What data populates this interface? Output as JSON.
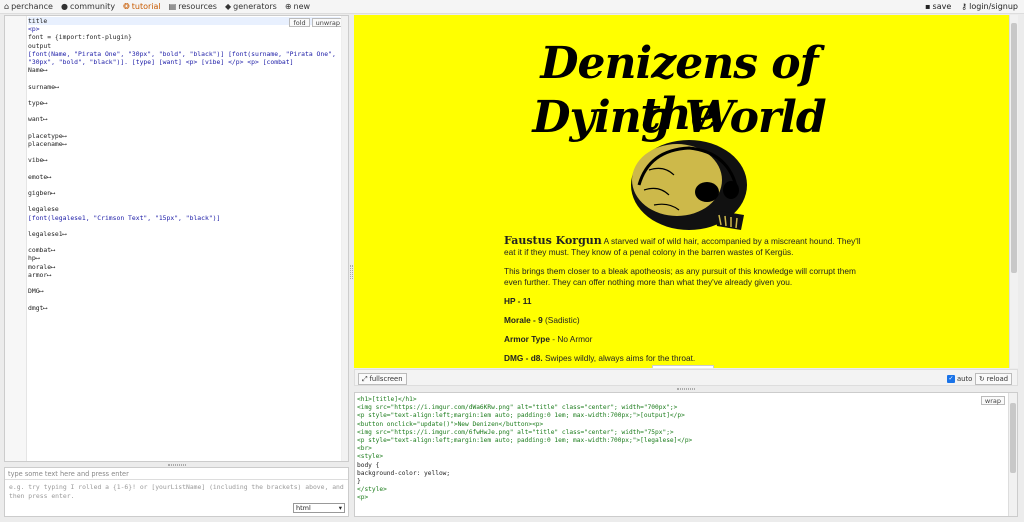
{
  "nav": {
    "items": [
      {
        "label": "perchance",
        "icon": "home-icon",
        "glyph": "⌂",
        "active": false
      },
      {
        "label": "community",
        "icon": "chat-icon",
        "glyph": "●",
        "active": false
      },
      {
        "label": "tutorial",
        "icon": "tutorial-icon",
        "glyph": "❂",
        "active": true
      },
      {
        "label": "resources",
        "icon": "resources-icon",
        "glyph": "▤",
        "active": false
      },
      {
        "label": "generators",
        "icon": "generators-icon",
        "glyph": "◆",
        "active": false
      },
      {
        "label": "new",
        "icon": "plus-circle-icon",
        "glyph": "⊕",
        "active": false
      }
    ],
    "save": "save",
    "login": "login/signup"
  },
  "editor": {
    "fold_label": "fold",
    "unwrap_label": "unwrap",
    "lines": [
      {
        "n": "1",
        "t": "title",
        "hl": true,
        "fold": true
      },
      {
        "n": "2",
        "t": "  <p>"
      },
      {
        "n": "3",
        "t": "font = {import:font-plugin}"
      },
      {
        "n": "4",
        "t": "output",
        "fold": true
      },
      {
        "n": "5",
        "t": "  [font(Name, \"Pirata One\", \"30px\", \"bold\", \"black\")] [font(surname, \"Pirata One\","
      },
      {
        "n": "",
        "t": "  \"30px\", \"bold\", \"black\")]. [type] [want] <p> [vibe] </p> <p> [combat]"
      },
      {
        "n": "6",
        "t": "Name⟷",
        "fold": true
      },
      {
        "n": "219",
        "t": ""
      },
      {
        "n": "220",
        "t": "surname⟷",
        "fold": true
      },
      {
        "n": "459",
        "t": ""
      },
      {
        "n": "460",
        "t": "type⟷",
        "fold": true
      },
      {
        "n": "561",
        "t": ""
      },
      {
        "n": "562",
        "t": "want⟷",
        "fold": true
      },
      {
        "n": "564",
        "t": ""
      },
      {
        "n": "565",
        "t": "placetype⟷",
        "fold": true
      },
      {
        "n": "568",
        "t": "placename⟷",
        "fold": true
      },
      {
        "n": "651",
        "t": ""
      },
      {
        "n": "652",
        "t": "vibe⟷",
        "fold": true
      },
      {
        "n": "654",
        "t": ""
      },
      {
        "n": "655",
        "t": "emote⟷",
        "fold": true
      },
      {
        "n": "680",
        "t": ""
      },
      {
        "n": "681",
        "t": "gigben⟷",
        "fold": true
      },
      {
        "n": "707",
        "t": ""
      },
      {
        "n": "708",
        "t": "legalese",
        "fold": true
      },
      {
        "n": "709",
        "t": "  [font(legalese1, \"Crimson Text\", \"15px\", \"black\")]"
      },
      {
        "n": "710",
        "t": ""
      },
      {
        "n": "711",
        "t": "legalese1⟷",
        "fold": true
      },
      {
        "n": "713",
        "t": ""
      },
      {
        "n": "714",
        "t": "combat⟷",
        "fold": true
      },
      {
        "n": "716",
        "t": "hp⟷",
        "fold": true
      },
      {
        "n": "741",
        "t": "morale⟷",
        "fold": true
      },
      {
        "n": "759",
        "t": "armor⟷",
        "fold": true
      },
      {
        "n": "768",
        "t": ""
      },
      {
        "n": "769",
        "t": "DMG⟷",
        "fold": true
      },
      {
        "n": "775",
        "t": ""
      },
      {
        "n": "776",
        "t": "dmgt⟷",
        "fold": true
      },
      {
        "n": "806",
        "t": ""
      },
      {
        "n": "807",
        "t": ""
      }
    ]
  },
  "input": {
    "placeholder": "type some text here and press enter",
    "help": "e.g. try typing I rolled a {1-6}! or [yourListName] (including the brackets) above, and then press enter.",
    "mode": "html"
  },
  "preview": {
    "title_line1": "Denizens of the",
    "title_line2": "Dying World",
    "name": "Faustus Korgun",
    "desc": "A starved waif of wild hair, accompanied by a miscreant hound. They'll eat it if they must. They know of a penal colony in the barren wastes of Kergüs.",
    "vibe": "This brings them closer to a bleak apotheosis; as any pursuit of this knowledge will corrupt them even further. They can offer nothing more than what they've already given you.",
    "hp": "HP - 11",
    "morale_label": "Morale - 9",
    "morale_value": " (Sadistic)",
    "armor_label": "Armor Type",
    "armor_value": " - No Armor",
    "dmg_label": "DMG - d8.",
    "dmg_value": " Swipes wildly, always aims for the throat."
  },
  "preview_bar": {
    "fullscreen": "fullscreen",
    "auto": "auto",
    "reload": "reload"
  },
  "html_editor": {
    "wrap_label": "wrap",
    "lines": [
      "<h1>[title]</h1>",
      "<img src=\"https://i.imgur.com/dWa6KRw.png\" alt=\"title\" class=\"center\"; width=\"700px\";>",
      "<p style=\"text-align:left;margin:1em auto; padding:0 1em; max-width:700px;\">[output]</p>",
      "<button onclick=\"update()\">New Denizen</button><p>",
      "  <img src=\"https://i.imgur.com/6fwHwJe.png\" alt=\"title\" class=\"center\"; width=\"75px\";>",
      "<p style=\"text-align:left;margin:1em auto; padding:0 1em; max-width:700px;\">[legalese]</p>",
      "<br>",
      "<style>",
      "  body {",
      "    background-color: yellow;",
      "  }",
      "</style>",
      "<p>"
    ]
  }
}
